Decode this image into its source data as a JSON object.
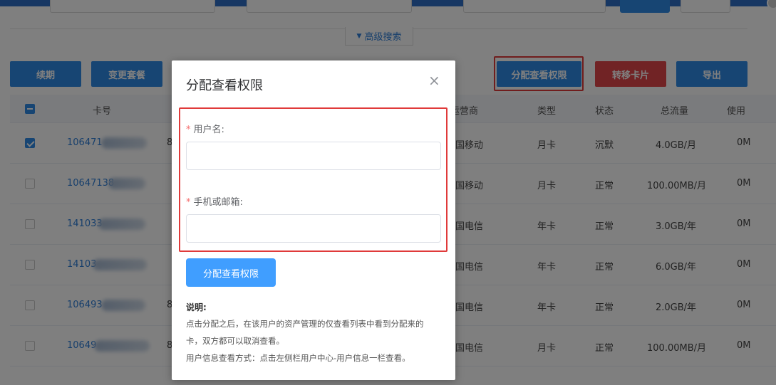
{
  "search": {
    "advanced_label": "高级搜索"
  },
  "toolbar": {
    "renew": "续期",
    "change_plan": "变更套餐",
    "assign_view": "分配查看权限",
    "transfer_card": "转移卡片",
    "export": "导出"
  },
  "table": {
    "headers": {
      "card_no": "卡号",
      "operator": "运营商",
      "type": "类型",
      "status": "状态",
      "total_traffic": "总流量",
      "usage": "使用"
    },
    "rows": [
      {
        "card": "106471",
        "extra": "8",
        "operator": "国移动",
        "type": "月卡",
        "status": "沉默",
        "traffic": "4.0GB/月",
        "usage": "0M",
        "checked": true
      },
      {
        "card": "10647138",
        "extra": "",
        "operator": "国移动",
        "type": "月卡",
        "status": "正常",
        "traffic": "100.00MB/月",
        "usage": "0M",
        "checked": false
      },
      {
        "card": "141033",
        "extra": "",
        "operator": "国电信",
        "type": "年卡",
        "status": "正常",
        "traffic": "3.0GB/年",
        "usage": "0M",
        "checked": false
      },
      {
        "card": "14103",
        "extra": "",
        "operator": "国电信",
        "type": "年卡",
        "status": "正常",
        "traffic": "6.0GB/年",
        "usage": "0M",
        "checked": false
      },
      {
        "card": "106493",
        "extra": "8",
        "operator": "国电信",
        "type": "年卡",
        "status": "正常",
        "traffic": "2.0GB/年",
        "usage": "0M",
        "checked": false
      },
      {
        "card": "10649",
        "extra": "8",
        "operator": "国电信",
        "type": "月卡",
        "status": "正常",
        "traffic": "100.00MB/月",
        "usage": "0M",
        "checked": false
      }
    ]
  },
  "modal": {
    "title": "分配查看权限",
    "close": "×",
    "username_label": "用户名:",
    "contact_label": "手机或邮箱:",
    "required_mark": "*",
    "submit": "分配查看权限",
    "note_title": "说明:",
    "note_line1": "点击分配之后，在该用户的资产管理的仅查看列表中看到分配来的",
    "note_line2": "卡，双方都可以取消查看。",
    "note_line3": "用户信息查看方式：点击左侧栏用户中心-用户信息一栏查看。"
  },
  "colors": {
    "primary": "#2f8be6",
    "danger": "#e2474b",
    "highlight": "#e03a3a",
    "modal_button": "#409eff"
  }
}
